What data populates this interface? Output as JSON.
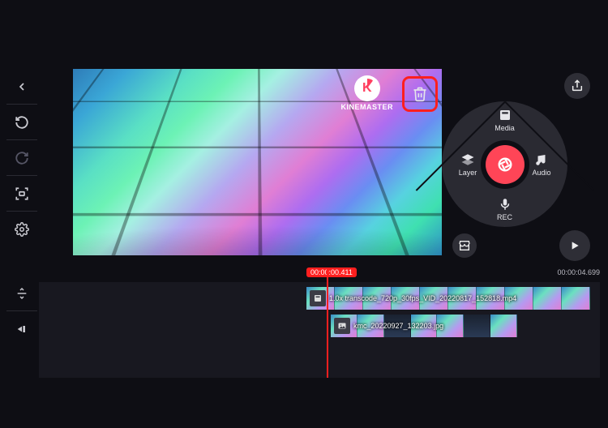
{
  "watermark": {
    "text": "KINEMASTER",
    "glyph": "K"
  },
  "wheel": {
    "media": "Media",
    "layer": "Layer",
    "audio": "Audio",
    "rec": "REC"
  },
  "timeline": {
    "current": "00:00:00.411",
    "total": "00:00:04.699"
  },
  "clips": {
    "video": "1.0x transcode_720p_30fps_VID_20220817_152818.mp4",
    "image": "kmc_20220927_132203.jpg"
  }
}
